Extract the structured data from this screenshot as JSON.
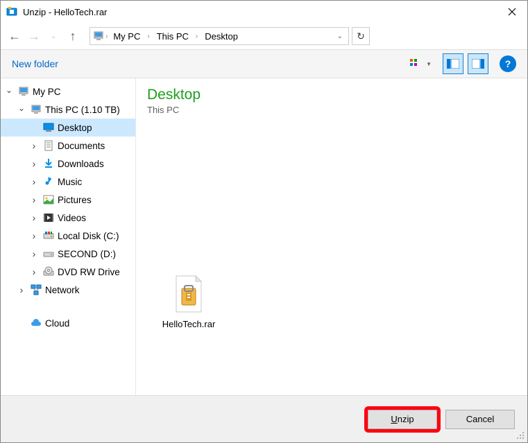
{
  "window": {
    "title": "Unzip - HelloTech.rar"
  },
  "breadcrumb": {
    "seg1": "My PC",
    "seg2": "This PC",
    "seg3": "Desktop"
  },
  "toolbar": {
    "new_folder_label": "New folder"
  },
  "tree": {
    "root": "My PC",
    "this_pc": "This PC (1.10 TB)",
    "desktop": "Desktop",
    "documents": "Documents",
    "downloads": "Downloads",
    "music": "Music",
    "pictures": "Pictures",
    "videos": "Videos",
    "local_disk": "Local Disk (C:)",
    "second": "SECOND (D:)",
    "dvd": "DVD RW Drive",
    "network": "Network",
    "cloud": "Cloud"
  },
  "content": {
    "location_title": "Desktop",
    "location_sub": "This PC",
    "file1_name": "HelloTech.rar"
  },
  "footer": {
    "unzip_label": "Unzip",
    "cancel_label": "Cancel"
  }
}
